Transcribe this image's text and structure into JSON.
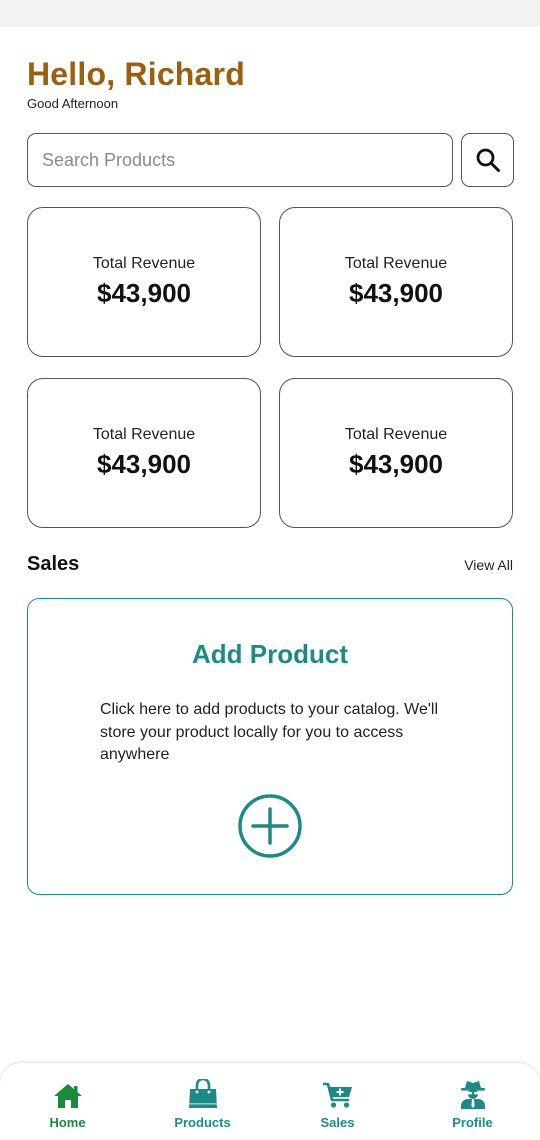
{
  "header": {
    "greeting": "Hello, Richard",
    "subtitle": "Good Afternoon"
  },
  "search": {
    "placeholder": "Search Products",
    "value": "",
    "button_icon": "search-icon"
  },
  "stats": [
    {
      "label": "Total Revenue",
      "value": "$43,900"
    },
    {
      "label": "Total Revenue",
      "value": "$43,900"
    },
    {
      "label": "Total Revenue",
      "value": "$43,900"
    },
    {
      "label": "Total Revenue",
      "value": "$43,900"
    }
  ],
  "sales_section": {
    "title": "Sales",
    "view_all": "View All"
  },
  "add_product": {
    "title": "Add Product",
    "description": "Click here to add products to your catalog. We'll store your product locally for you to access anywhere",
    "icon": "plus-circle-icon"
  },
  "bottom_nav": [
    {
      "label": "Home",
      "icon": "home-icon",
      "active": true
    },
    {
      "label": "Products",
      "icon": "shopping-bag-icon",
      "active": false
    },
    {
      "label": "Sales",
      "icon": "cart-add-icon",
      "active": false
    },
    {
      "label": "Profile",
      "icon": "user-spy-icon",
      "active": false
    }
  ],
  "colors": {
    "greeting": "#9a5f10",
    "accent_teal": "#1e8a86",
    "active_green": "#1a8a3c",
    "border": "#555555"
  }
}
